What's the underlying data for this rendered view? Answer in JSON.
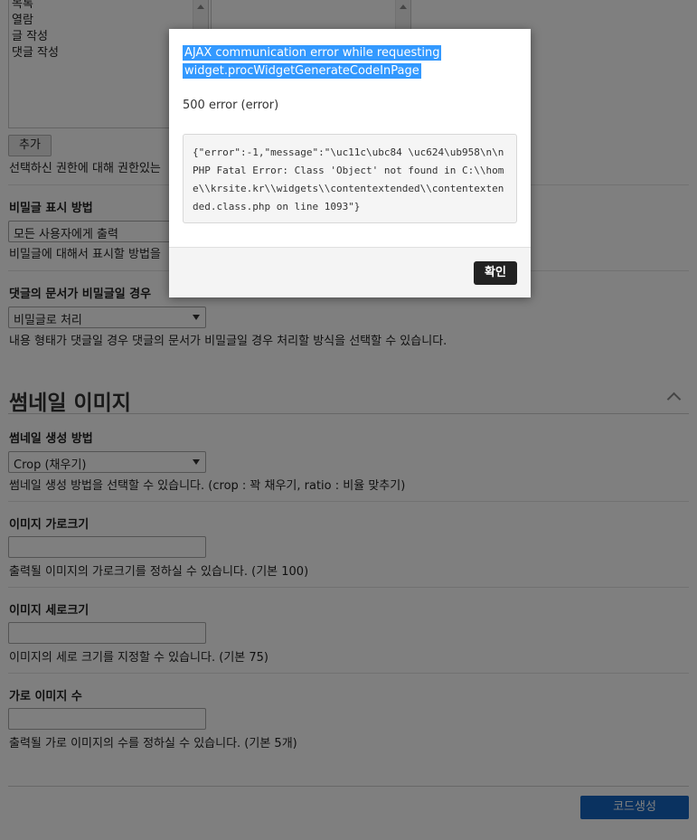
{
  "permissions": {
    "list_items": [
      "목록",
      "열람",
      "글 작성",
      "댓글 작성"
    ],
    "add_button": "추가",
    "help": "선택하신 권한에 대해 권한있는"
  },
  "secret_display": {
    "label": "비밀글 표시 방법",
    "selected": "모든 사용자에게 출력",
    "help": "비밀글에 대해서 표시할 방법을"
  },
  "comment_secret": {
    "label": "댓글의 문서가 비밀글일 경우",
    "selected": "비밀글로 처리",
    "help": "내용 형태가 댓글일 경우 댓글의 문서가 비밀글일 경우 처리할 방식을 선택할 수 있습니다."
  },
  "thumbnail_section": {
    "title": "썸네일 이미지"
  },
  "thumbnail_method": {
    "label": "썸네일 생성 방법",
    "selected": "Crop (채우기)",
    "help": "썸네일 생성 방법을 선택할 수 있습니다. (crop : 꽉 채우기, ratio : 비율 맞추기)"
  },
  "image_width": {
    "label": "이미지 가로크기",
    "value": "",
    "help": "출력될 이미지의 가로크기를 정하실 수 있습니다. (기본 100)"
  },
  "image_height": {
    "label": "이미지 세로크기",
    "value": "",
    "help": "이미지의 세로 크기를 지정할 수 있습니다. (기본 75)"
  },
  "horizontal_count": {
    "label": "가로 이미지 수",
    "value": "",
    "help": "출력될 가로 이미지의 수를 정하실 수 있습니다. (기본 5개)"
  },
  "generate_button": "코드생성",
  "modal": {
    "title_line1": "AJAX communication error while requesting",
    "title_line2": "widget.procWidgetGenerateCodeInPage",
    "status": "500 error (error)",
    "code": "{\"error\":-1,\"message\":\"\\uc11c\\ubc84 \\uc624\\ub958\\n\\nPHP Fatal Error: Class 'Object' not found in C:\\\\home\\\\krsite.kr\\\\widgets\\\\contentextended\\\\contentextended.class.php on line 1093\"}",
    "ok_button": "확인"
  },
  "colors": {
    "primary_button": "#1565c0",
    "highlight": "#3399ff",
    "ok_button": "#222222"
  }
}
